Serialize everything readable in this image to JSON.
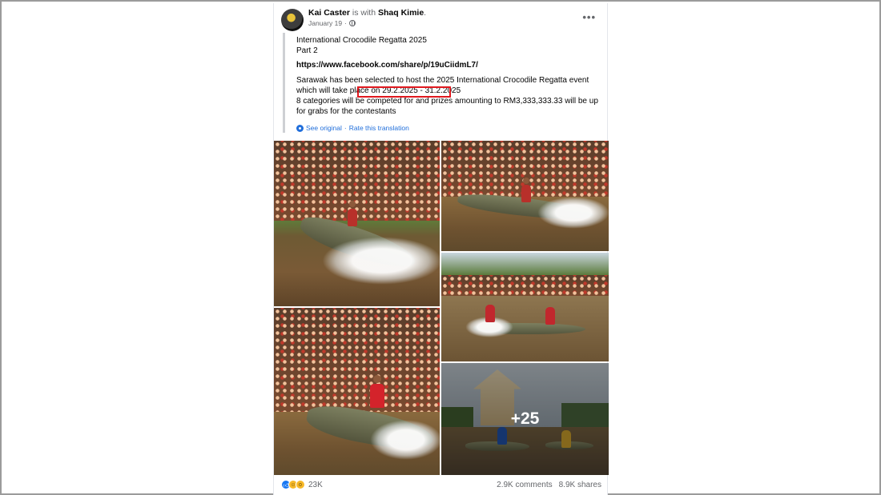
{
  "post": {
    "author": "Kai Caster",
    "with_text": "is with",
    "tagged": "Shaq Kimie",
    "date": "January 19",
    "date_sep": "·"
  },
  "quote": {
    "line1": "International Crocodile Regatta 2025",
    "line2": "Part 2",
    "link": "https://www.facebook.com/share/p/19uCiidmL7/",
    "body1": "Sarawak has been selected to host the 2025 International Crocodile Regatta event",
    "body2": "which will take place on 29.2.2025 - 31.2.2025",
    "body3": "8 categories will be competed for and prizes amounting to RM3,333,333.33 will be up",
    "body4": "for grabs for the contestants",
    "see_original": "See original",
    "dot": "·",
    "rate_translation": "Rate this translation"
  },
  "gallery": {
    "more_count": "+25",
    "photo_count": 5
  },
  "footer": {
    "reaction_count": "23K",
    "comments": "2.9K comments",
    "shares": "8.9K shares"
  },
  "colors": {
    "highlight": "#e0191f",
    "link_blue": "#216fdb",
    "like_blue": "#1877f2"
  },
  "icons": {
    "reactions": [
      "like-icon",
      "haha-icon",
      "wow-icon"
    ],
    "more": "more-options-icon",
    "privacy": "globe-icon",
    "translate": "gear-icon"
  }
}
